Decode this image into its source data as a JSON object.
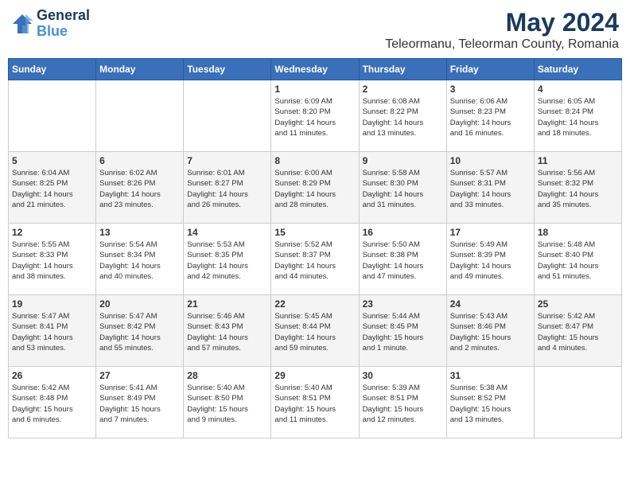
{
  "header": {
    "logo_line1": "General",
    "logo_line2": "Blue",
    "month": "May 2024",
    "location": "Teleormanu, Teleorman County, Romania"
  },
  "days_of_week": [
    "Sunday",
    "Monday",
    "Tuesday",
    "Wednesday",
    "Thursday",
    "Friday",
    "Saturday"
  ],
  "weeks": [
    [
      {
        "day": "",
        "content": ""
      },
      {
        "day": "",
        "content": ""
      },
      {
        "day": "",
        "content": ""
      },
      {
        "day": "1",
        "content": "Sunrise: 6:09 AM\nSunset: 8:20 PM\nDaylight: 14 hours\nand 11 minutes."
      },
      {
        "day": "2",
        "content": "Sunrise: 6:08 AM\nSunset: 8:22 PM\nDaylight: 14 hours\nand 13 minutes."
      },
      {
        "day": "3",
        "content": "Sunrise: 6:06 AM\nSunset: 8:23 PM\nDaylight: 14 hours\nand 16 minutes."
      },
      {
        "day": "4",
        "content": "Sunrise: 6:05 AM\nSunset: 8:24 PM\nDaylight: 14 hours\nand 18 minutes."
      }
    ],
    [
      {
        "day": "5",
        "content": "Sunrise: 6:04 AM\nSunset: 8:25 PM\nDaylight: 14 hours\nand 21 minutes."
      },
      {
        "day": "6",
        "content": "Sunrise: 6:02 AM\nSunset: 8:26 PM\nDaylight: 14 hours\nand 23 minutes."
      },
      {
        "day": "7",
        "content": "Sunrise: 6:01 AM\nSunset: 8:27 PM\nDaylight: 14 hours\nand 26 minutes."
      },
      {
        "day": "8",
        "content": "Sunrise: 6:00 AM\nSunset: 8:29 PM\nDaylight: 14 hours\nand 28 minutes."
      },
      {
        "day": "9",
        "content": "Sunrise: 5:58 AM\nSunset: 8:30 PM\nDaylight: 14 hours\nand 31 minutes."
      },
      {
        "day": "10",
        "content": "Sunrise: 5:57 AM\nSunset: 8:31 PM\nDaylight: 14 hours\nand 33 minutes."
      },
      {
        "day": "11",
        "content": "Sunrise: 5:56 AM\nSunset: 8:32 PM\nDaylight: 14 hours\nand 35 minutes."
      }
    ],
    [
      {
        "day": "12",
        "content": "Sunrise: 5:55 AM\nSunset: 8:33 PM\nDaylight: 14 hours\nand 38 minutes."
      },
      {
        "day": "13",
        "content": "Sunrise: 5:54 AM\nSunset: 8:34 PM\nDaylight: 14 hours\nand 40 minutes."
      },
      {
        "day": "14",
        "content": "Sunrise: 5:53 AM\nSunset: 8:35 PM\nDaylight: 14 hours\nand 42 minutes."
      },
      {
        "day": "15",
        "content": "Sunrise: 5:52 AM\nSunset: 8:37 PM\nDaylight: 14 hours\nand 44 minutes."
      },
      {
        "day": "16",
        "content": "Sunrise: 5:50 AM\nSunset: 8:38 PM\nDaylight: 14 hours\nand 47 minutes."
      },
      {
        "day": "17",
        "content": "Sunrise: 5:49 AM\nSunset: 8:39 PM\nDaylight: 14 hours\nand 49 minutes."
      },
      {
        "day": "18",
        "content": "Sunrise: 5:48 AM\nSunset: 8:40 PM\nDaylight: 14 hours\nand 51 minutes."
      }
    ],
    [
      {
        "day": "19",
        "content": "Sunrise: 5:47 AM\nSunset: 8:41 PM\nDaylight: 14 hours\nand 53 minutes."
      },
      {
        "day": "20",
        "content": "Sunrise: 5:47 AM\nSunset: 8:42 PM\nDaylight: 14 hours\nand 55 minutes."
      },
      {
        "day": "21",
        "content": "Sunrise: 5:46 AM\nSunset: 8:43 PM\nDaylight: 14 hours\nand 57 minutes."
      },
      {
        "day": "22",
        "content": "Sunrise: 5:45 AM\nSunset: 8:44 PM\nDaylight: 14 hours\nand 59 minutes."
      },
      {
        "day": "23",
        "content": "Sunrise: 5:44 AM\nSunset: 8:45 PM\nDaylight: 15 hours\nand 1 minute."
      },
      {
        "day": "24",
        "content": "Sunrise: 5:43 AM\nSunset: 8:46 PM\nDaylight: 15 hours\nand 2 minutes."
      },
      {
        "day": "25",
        "content": "Sunrise: 5:42 AM\nSunset: 8:47 PM\nDaylight: 15 hours\nand 4 minutes."
      }
    ],
    [
      {
        "day": "26",
        "content": "Sunrise: 5:42 AM\nSunset: 8:48 PM\nDaylight: 15 hours\nand 6 minutes."
      },
      {
        "day": "27",
        "content": "Sunrise: 5:41 AM\nSunset: 8:49 PM\nDaylight: 15 hours\nand 7 minutes."
      },
      {
        "day": "28",
        "content": "Sunrise: 5:40 AM\nSunset: 8:50 PM\nDaylight: 15 hours\nand 9 minutes."
      },
      {
        "day": "29",
        "content": "Sunrise: 5:40 AM\nSunset: 8:51 PM\nDaylight: 15 hours\nand 11 minutes."
      },
      {
        "day": "30",
        "content": "Sunrise: 5:39 AM\nSunset: 8:51 PM\nDaylight: 15 hours\nand 12 minutes."
      },
      {
        "day": "31",
        "content": "Sunrise: 5:38 AM\nSunset: 8:52 PM\nDaylight: 15 hours\nand 13 minutes."
      },
      {
        "day": "",
        "content": ""
      }
    ]
  ]
}
